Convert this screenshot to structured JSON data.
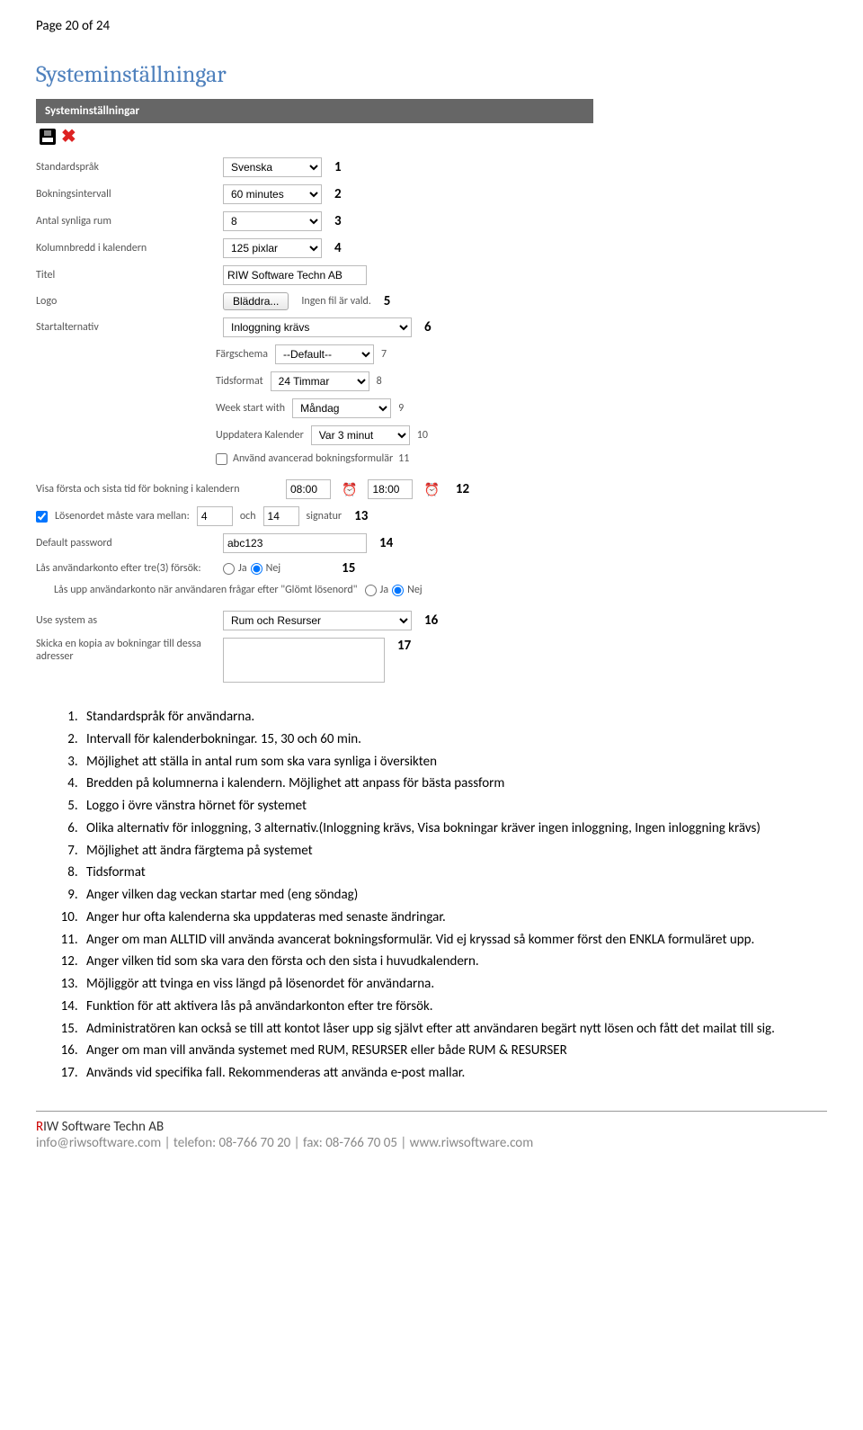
{
  "page_indicator": "Page 20 of 24",
  "section_heading": "Systeminställningar",
  "panel_title": "Systeminställningar",
  "annotations": {
    "n1": "1",
    "n2": "2",
    "n3": "3",
    "n4": "4",
    "n5": "5",
    "n6": "6",
    "n7": "7",
    "n8": "8",
    "n9": "9",
    "n10": "10",
    "n11": "11",
    "n12": "12",
    "n13": "13",
    "n14": "14",
    "n15": "15",
    "n16": "16",
    "n17": "17"
  },
  "form": {
    "std_lang_label": "Standardspråk",
    "std_lang_value": "Svenska",
    "booking_interval_label": "Bokningsintervall",
    "booking_interval_value": "60 minutes",
    "visible_rooms_label": "Antal synliga rum",
    "visible_rooms_value": "8",
    "col_width_label": "Kolumnbredd i kalendern",
    "col_width_value": "125 pixlar",
    "title_label": "Titel",
    "title_value": "RIW Software Techn AB",
    "logo_label": "Logo",
    "browse_btn": "Bläddra...",
    "no_file": "Ingen fil är vald.",
    "start_option_label": "Startalternativ",
    "start_option_value": "Inloggning krävs",
    "color_scheme_label": "Färgschema",
    "color_scheme_value": "--Default--",
    "time_format_label": "Tidsformat",
    "time_format_value": "24 Timmar",
    "week_start_label": "Week start with",
    "week_start_value": "Måndag",
    "update_cal_label": "Uppdatera Kalender",
    "update_cal_value": "Var 3 minut",
    "advanced_form_label": "Använd avancerad bokningsformulär",
    "first_last_label": "Visa första och sista tid för bokning i kalendern",
    "time_start": "08:00",
    "time_end": "18:00",
    "pw_between_label": "Lösenordet måste vara mellan:",
    "pw_min": "4",
    "pw_and": "och",
    "pw_max": "14",
    "pw_sign": "signatur",
    "default_pw_label": "Default password",
    "default_pw_value": "abc123",
    "lock_after3_label": "Lås användarkonto efter tre(3) försök:",
    "unlock_label": "Lås upp användarkonto när användaren frågar efter \"Glömt lösenord\"",
    "yes": "Ja",
    "no": "Nej",
    "use_system_label": "Use system as",
    "use_system_value": "Rum och Resurser",
    "copy_label": "Skicka en kopia av bokningar till dessa adresser"
  },
  "list": [
    "Standardspråk för användarna.",
    "Intervall för kalenderbokningar. 15, 30 och 60 min.",
    "Möjlighet att ställa in antal rum som ska vara synliga i översikten",
    "Bredden på kolumnerna i kalendern. Möjlighet att anpass för bästa passform",
    "Loggo i övre vänstra hörnet för systemet",
    "Olika alternativ för inloggning, 3 alternativ.(Inloggning krävs, Visa bokningar kräver ingen inloggning, Ingen inloggning krävs)",
    "Möjlighet att ändra färgtema på systemet",
    "Tidsformat",
    "Anger vilken dag veckan startar med (eng söndag)",
    "Anger hur ofta kalenderna ska uppdateras med senaste ändringar.",
    "Anger om man ALLTID vill använda avancerat bokningsformulär. Vid ej kryssad så kommer först den ENKLA formuläret upp.",
    "Anger vilken tid som ska vara den första och den sista i huvudkalendern.",
    "Möjliggör att tvinga en viss längd på lösenordet för användarna.",
    "Funktion för att aktivera lås på användarkonton efter tre försök.",
    "Administratören kan också se till att kontot låser upp sig självt efter att användaren begärt nytt lösen och fått det mailat till sig.",
    "Anger om man vill använda systemet med RUM, RESURSER eller både RUM & RESURSER",
    "Används vid specifika fall. Rekommenderas att använda e-post mallar."
  ],
  "footer": {
    "company_r": "R",
    "company_rest": "IW Software Techn AB",
    "line2": "info@riwsoftware.com | telefon: 08-766 70 20 | fax: 08-766 70 05 | www.riwsoftware.com"
  }
}
